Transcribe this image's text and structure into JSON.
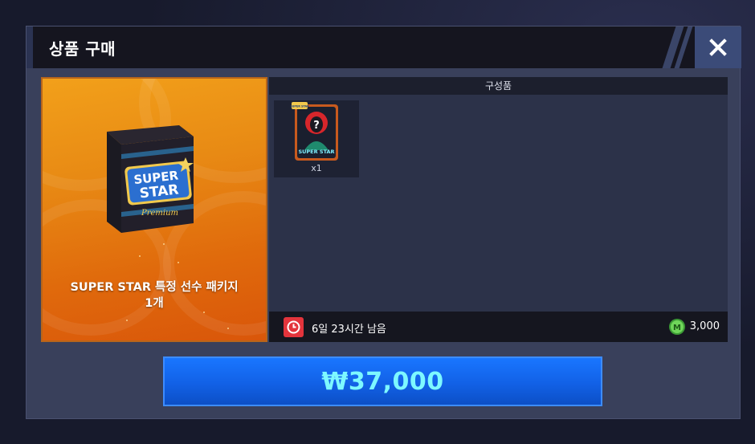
{
  "dialog": {
    "title": "상품 구매",
    "close_label": "✕"
  },
  "product": {
    "name_line1": "SUPER STAR 특정 선수 패키지",
    "name_line2": "1개",
    "box_badge_line1": "SUPER",
    "box_badge_line2": "STAR",
    "box_subtitle": "Premium"
  },
  "contents": {
    "header": "구성품",
    "items": [
      {
        "badge": "SUPER STAR",
        "mini_logo": "SUPER STAR",
        "mystery_symbol": "?",
        "quantity": "x1"
      }
    ]
  },
  "footer": {
    "time_remaining": "6일 23시간 남음",
    "coin_icon_letter": "M",
    "bonus_amount": "3,000"
  },
  "buy_button": {
    "price": "₩37,000"
  },
  "colors": {
    "product_bg": "#e88a14",
    "buy_button": "#1261e6",
    "price_text": "#7df8ff",
    "timer_icon": "#e3343c",
    "coin": "#5cc84a"
  },
  "icons": {
    "close": "close-icon",
    "timer": "clock-icon",
    "coin": "mileage-coin-icon"
  }
}
